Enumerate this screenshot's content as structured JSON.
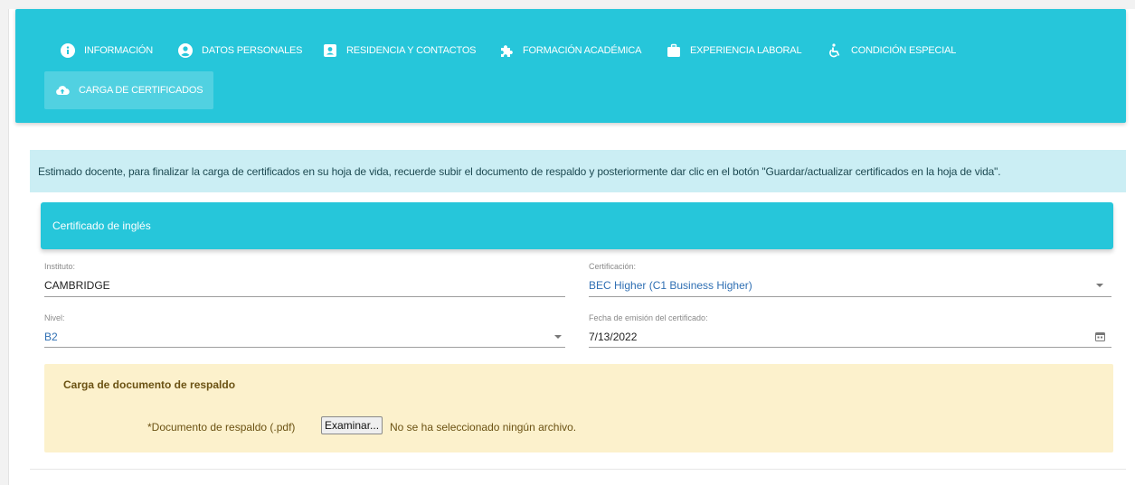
{
  "nav": {
    "items": [
      {
        "icon": "info-circle-icon",
        "label": "INFORMACIÓN"
      },
      {
        "icon": "user-circle-icon",
        "label": "DATOS PERSONALES"
      },
      {
        "icon": "contact-card-icon",
        "label": "RESIDENCIA Y CONTACTOS"
      },
      {
        "icon": "puzzle-icon",
        "label": "FORMACIÓN ACADÉMICA"
      },
      {
        "icon": "briefcase-icon",
        "label": "EXPERIENCIA LABORAL"
      },
      {
        "icon": "wheelchair-icon",
        "label": "CONDICIÓN ESPECIAL"
      },
      {
        "icon": "cloud-upload-icon",
        "label": "CARGA DE CERTIFICADOS",
        "active": true
      }
    ]
  },
  "alert": {
    "text": "Estimado docente, para finalizar la carga de certificados en su hoja de vida, recuerde subir el documento de respaldo y posteriormente dar clic en el botón \"Guardar/actualizar certificados en la hoja de vida\"."
  },
  "card": {
    "title": "Certificado de inglés"
  },
  "form": {
    "instituto": {
      "label": "Instituto:",
      "value": "CAMBRIDGE"
    },
    "certificacion": {
      "label": "Certificación:",
      "value": "BEC Higher (C1 Business Higher)"
    },
    "nivel": {
      "label": "Nivel:",
      "value": "B2"
    },
    "fecha": {
      "label": "Fecha de emisión del certificado:",
      "value": "7/13/2022"
    }
  },
  "upload": {
    "title": "Carga de documento de respaldo",
    "file_label": "*Documento de respaldo (.pdf)",
    "browse_button": "Examinar...",
    "no_file_text": "No se ha seleccionado ningún archivo."
  },
  "colors": {
    "primary": "#26c6da",
    "alert_bg": "#cbeef4",
    "upload_bg": "#fcf1cc",
    "select_value": "#2f6fb3"
  }
}
